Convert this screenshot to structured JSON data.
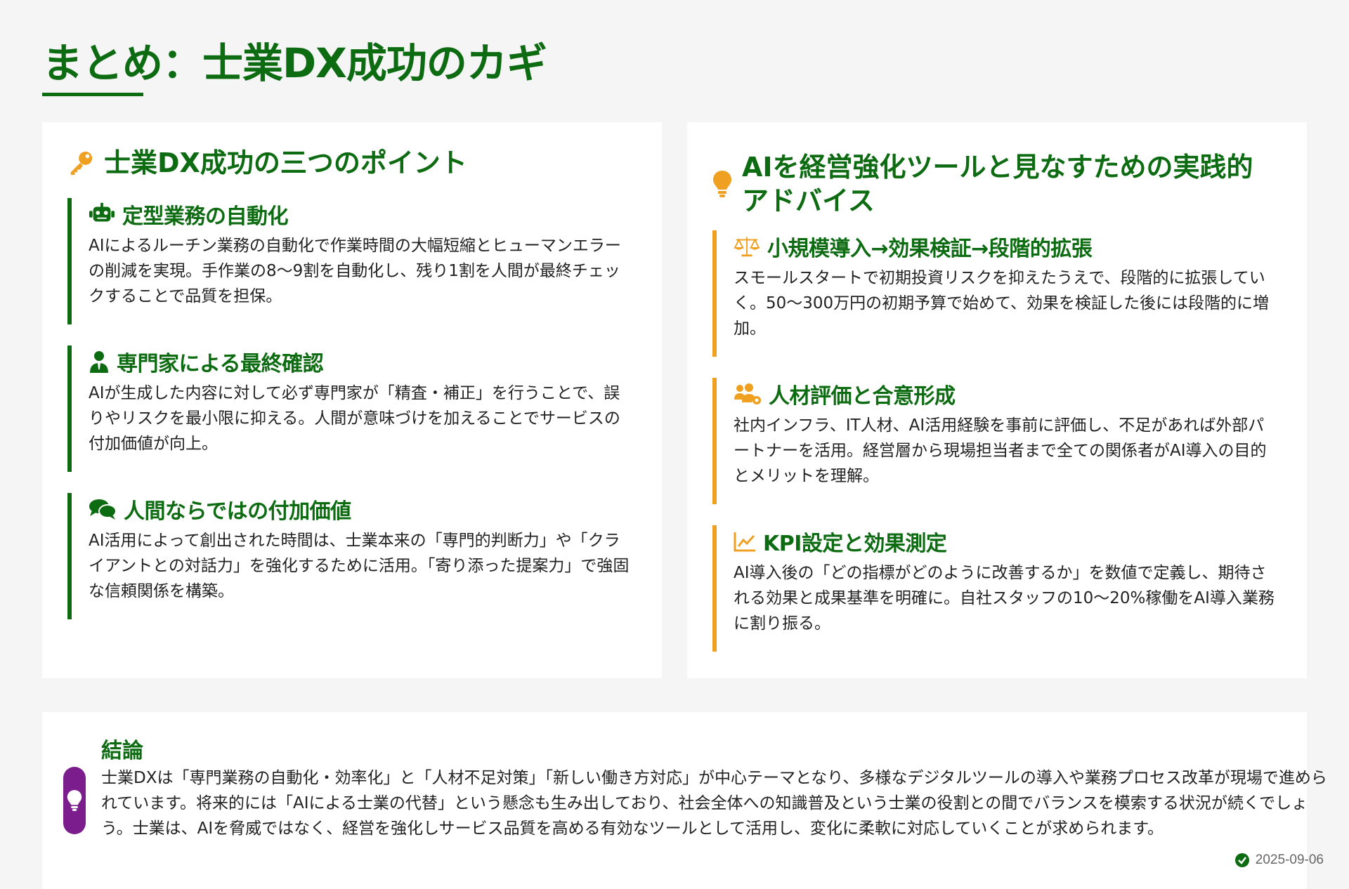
{
  "page": {
    "title": "まとめ：士業DX成功のカギ"
  },
  "left_card": {
    "title": "士業DX成功の三つのポイント",
    "icon": "key-icon",
    "items": [
      {
        "icon": "robot-icon",
        "title": "定型業務の自動化",
        "body": "AIによるルーチン業務の自動化で作業時間の大幅短縮とヒューマンエラーの削減を実現。手作業の8～9割を自動化し、残り1割を人間が最終チェックすることで品質を担保。"
      },
      {
        "icon": "user-tie-icon",
        "title": "専門家による最終確認",
        "body": "AIが生成した内容に対して必ず専門家が「精査・補正」を行うことで、誤りやリスクを最小限に抑える。人間が意味づけを加えることでサービスの付加価値が向上。"
      },
      {
        "icon": "comments-icon",
        "title": "人間ならではの付加価値",
        "body": "AI活用によって創出された時間は、士業本来の「専門的判断力」や「クライアントとの対話力」を強化するために活用。「寄り添った提案力」で強固な信頼関係を構築。"
      }
    ]
  },
  "right_card": {
    "title": "AIを経営強化ツールと見なすための実践的アドバイス",
    "icon": "lightbulb-icon",
    "items": [
      {
        "icon": "balance-scale-icon",
        "title": "小規模導入→効果検証→段階的拡張",
        "body": "スモールスタートで初期投資リスクを抑えたうえで、段階的に拡張していく。50～300万円の初期予算で始めて、効果を検証した後には段階的に増加。"
      },
      {
        "icon": "users-cog-icon",
        "title": "人材評価と合意形成",
        "body": "社内インフラ、IT人材、AI活用経験を事前に評価し、不足があれば外部パートナーを活用。経営層から現場担当者まで全ての関係者がAI導入の目的とメリットを理解。"
      },
      {
        "icon": "chart-line-icon",
        "title": "KPI設定と効果測定",
        "body": "AI導入後の「どの指標がどのように改善するか」を数値で定義し、期待される効果と成果基準を明確に。自社スタッフの10～20%稼働をAI導入業務に割り振る。"
      }
    ]
  },
  "conclusion": {
    "icon": "lightbulb-icon",
    "title": "結論",
    "body": "士業DXは「専門業務の自動化・効率化」と「人材不足対策」「新しい働き方対応」が中心テーマとなり、多様なデジタルツールの導入や業務プロセス改革が現場で進められています。将来的には「AIによる士業の代替」という懸念も生み出しており、社会全体への知識普及という士業の役割との間でバランスを模索する状況が続くでしょう。士業は、AIを脅威ではなく、経営を強化しサービス品質を高める有効なツールとして活用し、変化に柔軟に対応していくことが求められます。"
  },
  "footer": {
    "date": "2025-09-06",
    "icon": "check-circle-icon"
  },
  "colors": {
    "primary_green": "#0d6b12",
    "accent_orange": "#f0a020",
    "conclusion_purple": "#7b1d8c",
    "background": "#f5f5f5"
  }
}
